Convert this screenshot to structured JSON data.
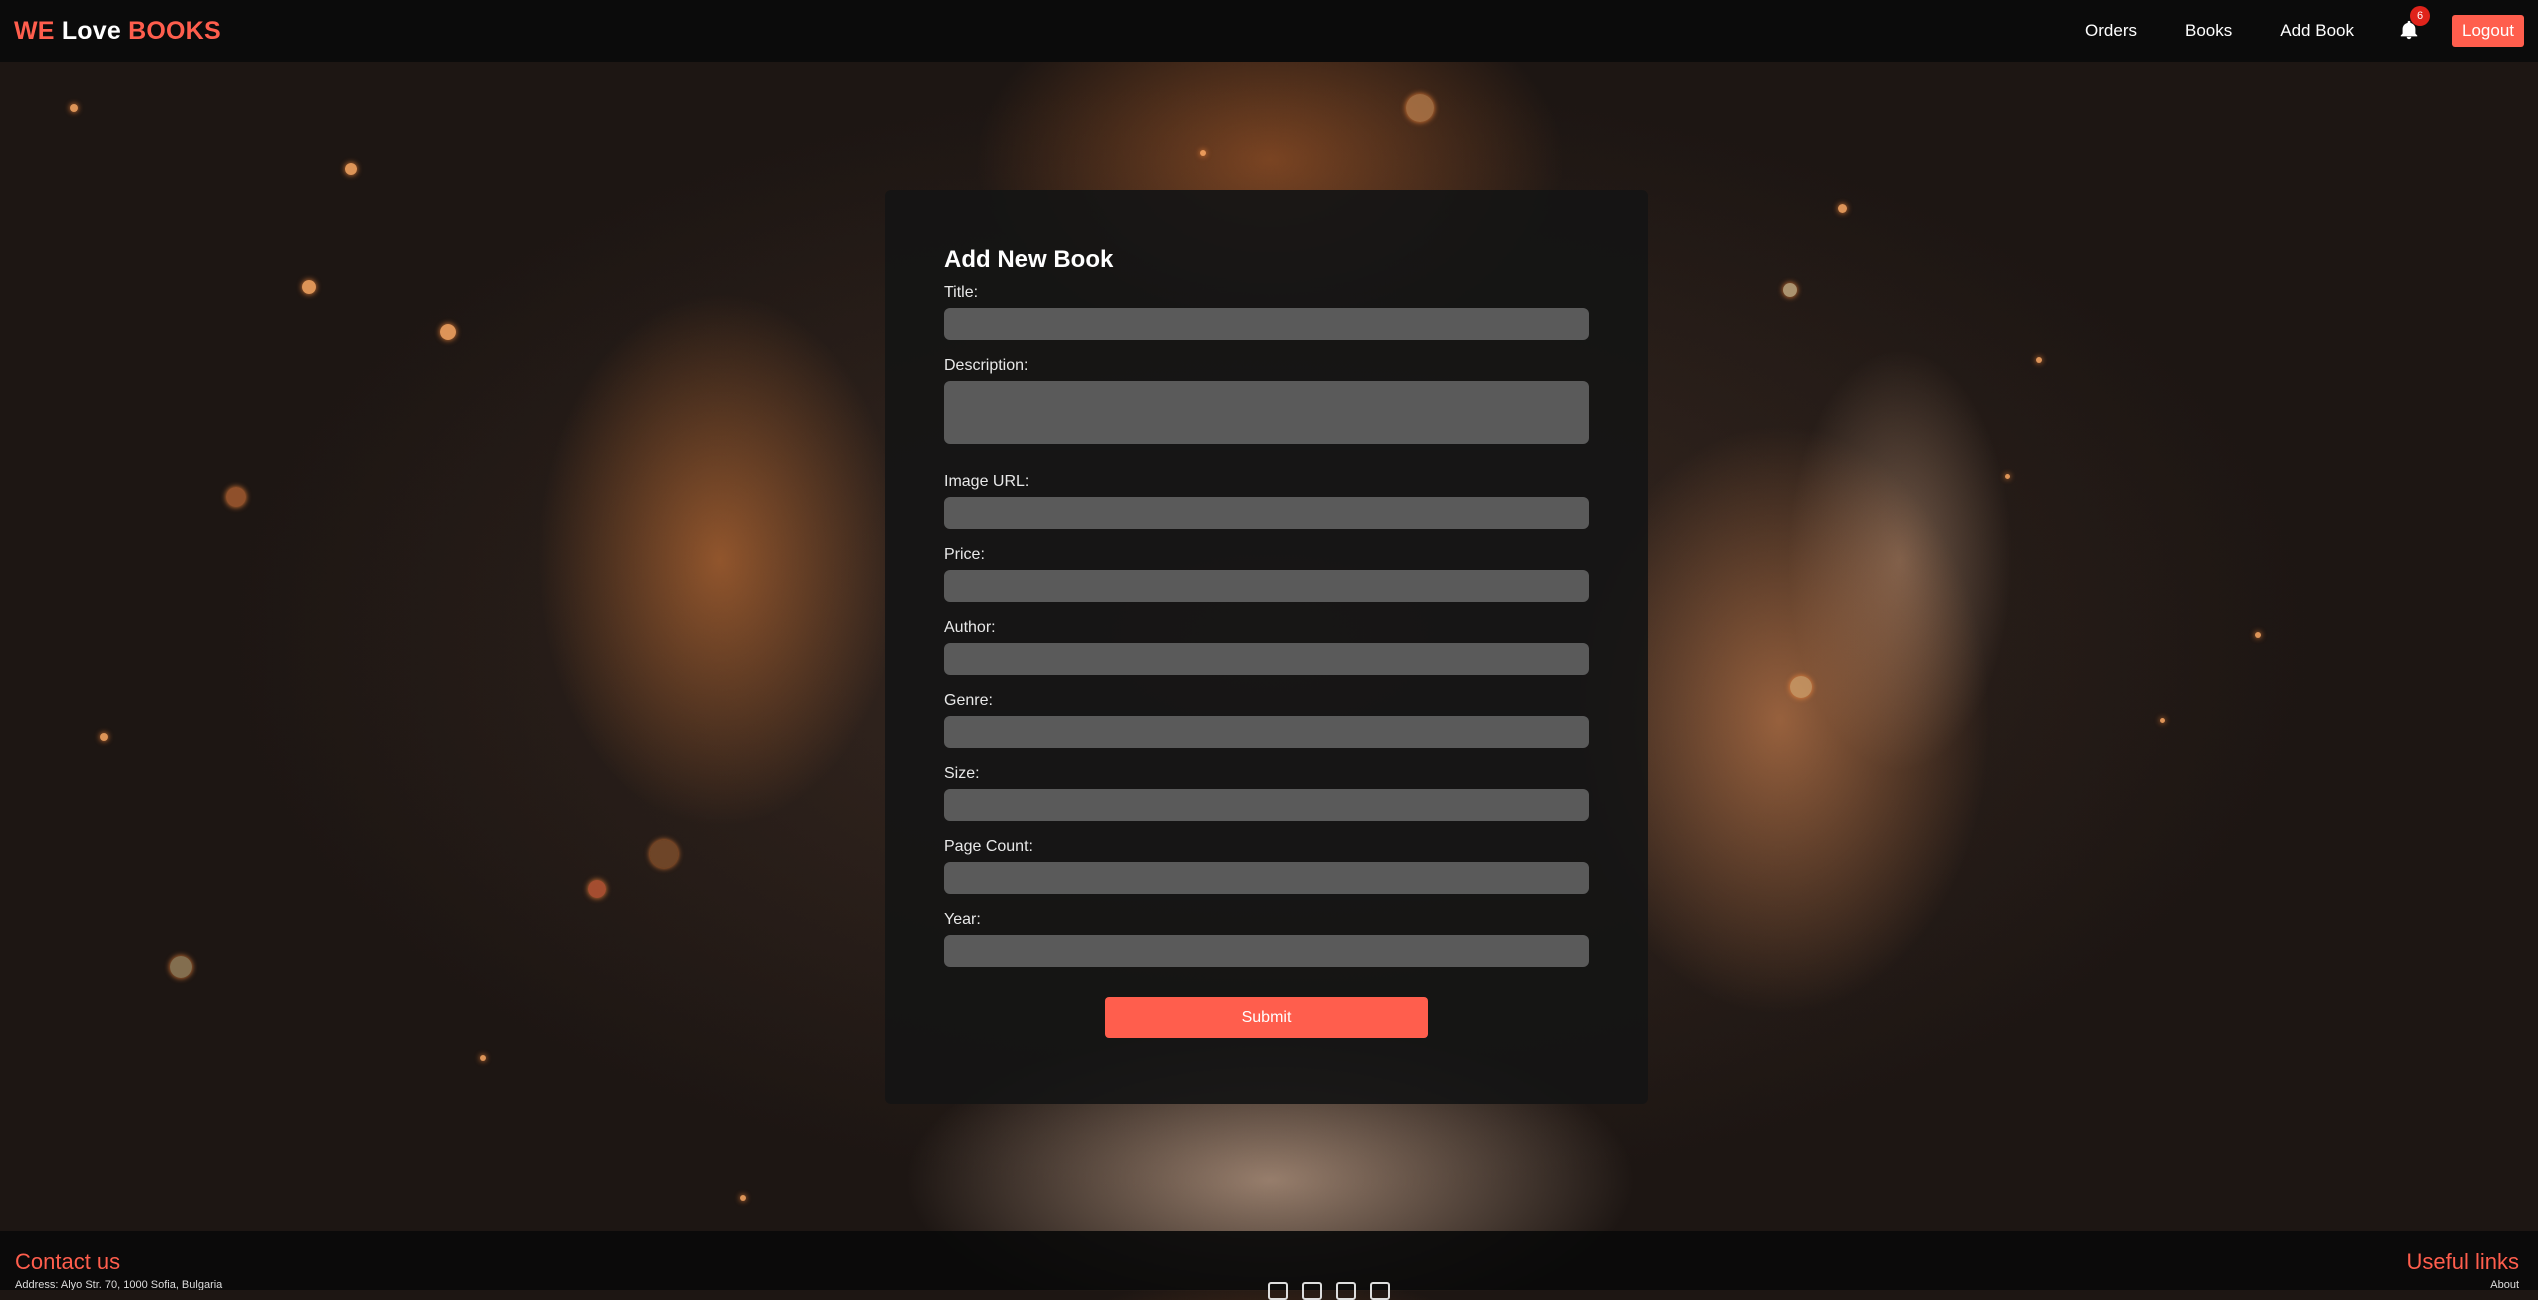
{
  "header": {
    "logo": {
      "part1": "WE",
      "part2": "Love",
      "part3": "BOOKS"
    },
    "nav": [
      {
        "label": "Orders"
      },
      {
        "label": "Books"
      },
      {
        "label": "Add Book"
      }
    ],
    "notifications": {
      "icon": "bell-icon",
      "count": "6"
    },
    "logout_label": "Logout"
  },
  "form": {
    "title": "Add New Book",
    "fields": {
      "title": {
        "label": "Title:",
        "value": ""
      },
      "description": {
        "label": "Description:",
        "value": ""
      },
      "image_url": {
        "label": "Image URL:",
        "value": ""
      },
      "price": {
        "label": "Price:",
        "value": ""
      },
      "author": {
        "label": "Author:",
        "value": ""
      },
      "genre": {
        "label": "Genre:",
        "value": ""
      },
      "size": {
        "label": "Size:",
        "value": ""
      },
      "page_count": {
        "label": "Page Count:",
        "value": ""
      },
      "year": {
        "label": "Year:",
        "value": ""
      }
    },
    "submit_label": "Submit"
  },
  "footer": {
    "contact_title": "Contact us",
    "address": "Address: Alyo Str. 70, 1000 Sofia, Bulgaria",
    "links_title": "Useful links",
    "first_link": "About"
  },
  "colors": {
    "accent": "#ff5e4d",
    "navbar": "#0b0b0b",
    "input": "#5a5a5a",
    "badge": "#e0231b"
  }
}
